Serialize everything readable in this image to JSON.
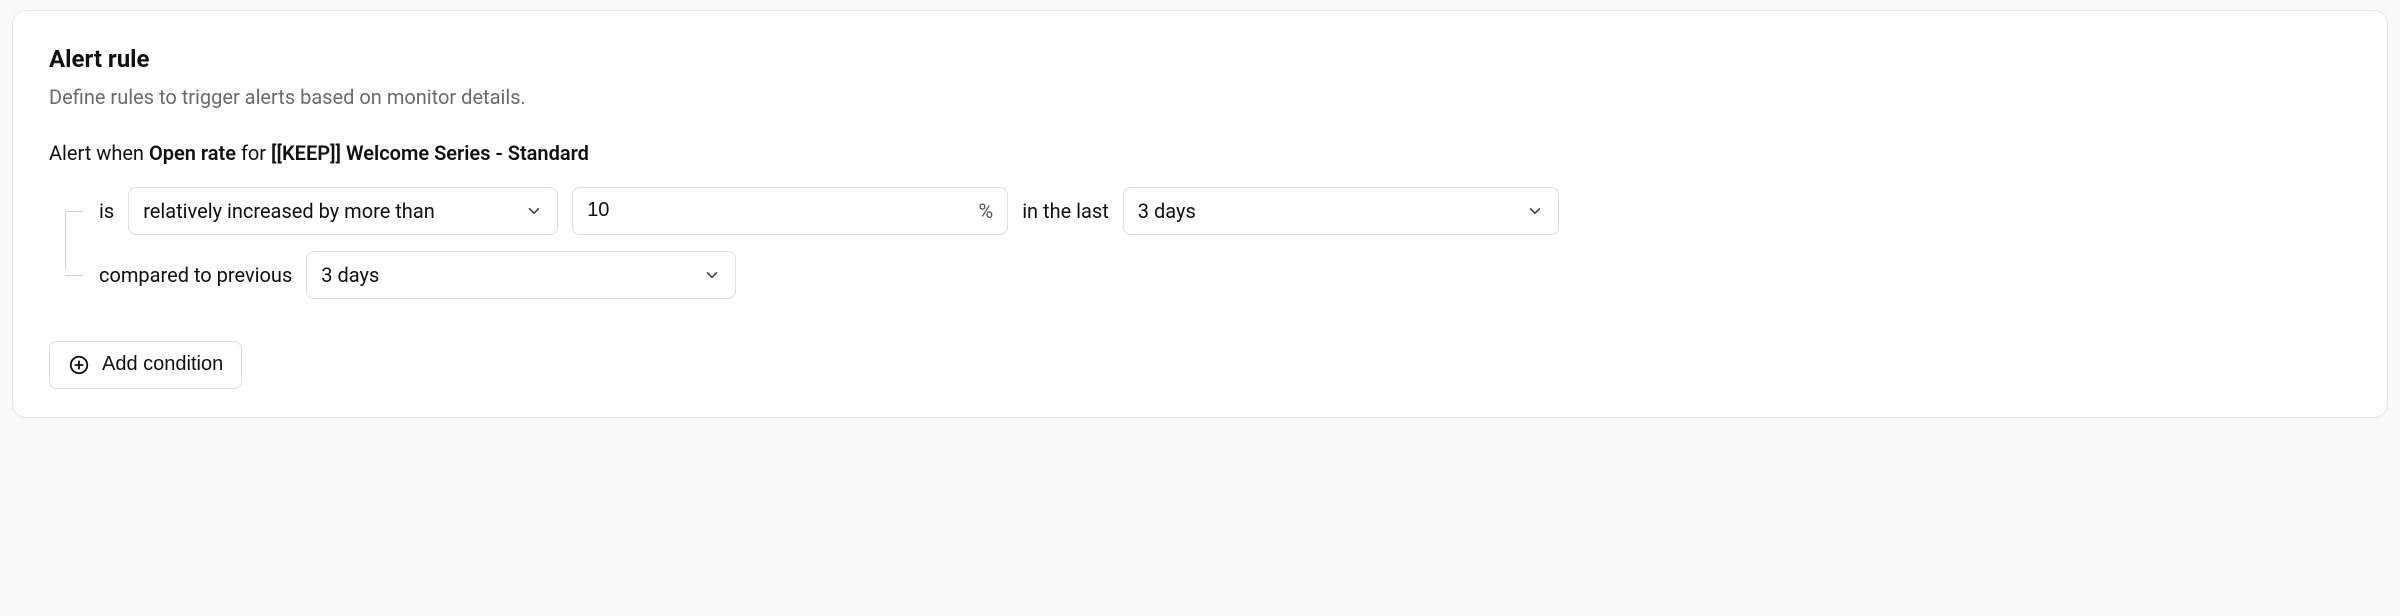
{
  "card": {
    "title": "Alert rule",
    "subtitle": "Define rules to trigger alerts based on monitor details."
  },
  "sentence": {
    "prefix": "Alert when ",
    "metric": "Open rate",
    "for_text": " for ",
    "flow_name": "[[KEEP]] Welcome Series - Standard"
  },
  "rule": {
    "is_label": "is",
    "comparator_value": "relatively increased by more than",
    "threshold_value": "10",
    "threshold_unit": "%",
    "in_the_last_label": "in the last",
    "timerange_value": "3 days",
    "compared_to_label": "compared to previous",
    "baseline_value": "3 days"
  },
  "actions": {
    "add_condition_label": "Add condition"
  }
}
